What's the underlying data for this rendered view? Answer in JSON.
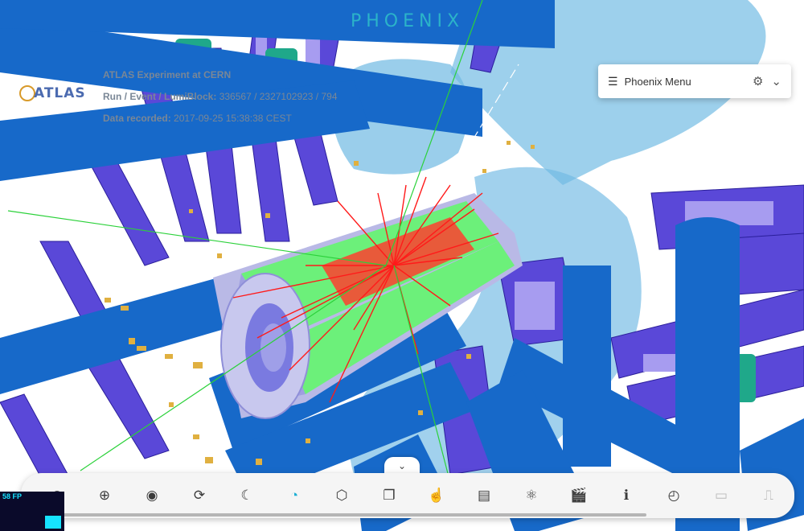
{
  "brand": {
    "title": "PHOENIX"
  },
  "logo": {
    "text": "ATLAS"
  },
  "event_info": {
    "experiment": "ATLAS Experiment at CERN",
    "run_label": "Run / Event / LumiBlock:",
    "run_value": " 336567 / 2327102923 / 794",
    "date_label": "Data recorded:",
    "date_value": " 2017-09-25 15:38:38 CEST"
  },
  "menu": {
    "title": "Phoenix Menu",
    "list_icon": "list-icon",
    "gear_icon": "gear-icon",
    "chevron_icon": "chevron-down-icon"
  },
  "collapse": {
    "icon": "chevron-down-icon",
    "glyph": "⌄"
  },
  "toolbar": {
    "tools": [
      {
        "name": "zoom-out-icon",
        "glyph": "⊖"
      },
      {
        "name": "zoom-in-icon",
        "glyph": "⊕"
      },
      {
        "name": "eye-icon",
        "glyph": "◉"
      },
      {
        "name": "rotate-icon",
        "glyph": "⟳"
      },
      {
        "name": "dark-mode-icon",
        "glyph": "☾"
      },
      {
        "name": "camera-angle-icon",
        "glyph": "◔",
        "active": true
      },
      {
        "name": "cube-icon",
        "glyph": "⬡"
      },
      {
        "name": "overlay-icon",
        "glyph": "❐"
      },
      {
        "name": "object-select-icon",
        "glyph": "☝"
      },
      {
        "name": "info-panel-icon",
        "glyph": "▤"
      },
      {
        "name": "atom-icon",
        "glyph": "⚛"
      },
      {
        "name": "animate-icon",
        "glyph": "🎬"
      },
      {
        "name": "info-icon",
        "glyph": "ℹ"
      },
      {
        "name": "performance-icon",
        "glyph": "◴"
      },
      {
        "name": "vr-icon",
        "glyph": "▭",
        "dim": true
      },
      {
        "name": "ar-icon",
        "glyph": "⎍",
        "dim": true
      }
    ]
  },
  "fps": {
    "label": "58 FP"
  },
  "colors": {
    "accent": "#1eb0d4",
    "structure_purple": "#5a48d8",
    "pipe_blue": "#1769c9",
    "tracks": "#ff1a1a",
    "calorimeter_green": "#6cf07a",
    "hits": "#e0b040",
    "lightblue": "#6fb9e3"
  }
}
